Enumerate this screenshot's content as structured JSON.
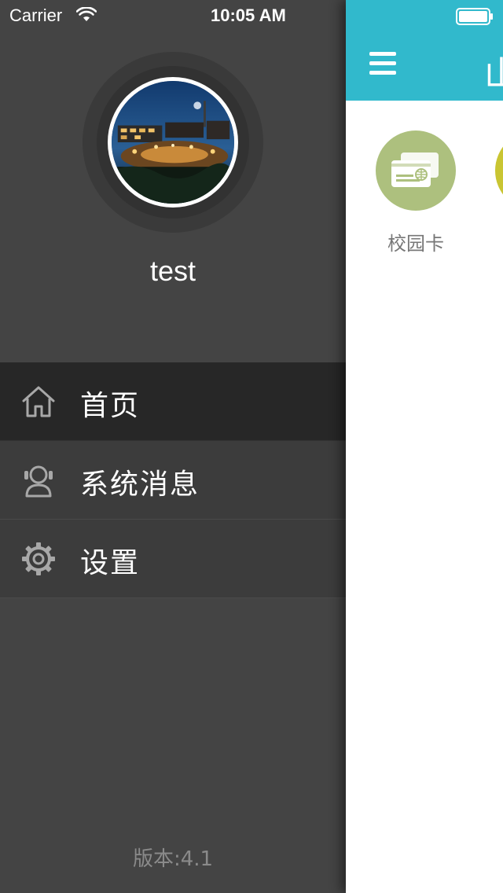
{
  "status_bar": {
    "carrier": "Carrier",
    "time": "10:05 AM",
    "wifi_icon": "wifi-icon",
    "battery_icon": "battery-icon"
  },
  "drawer": {
    "avatar_icon": "user-avatar-campus-night-photo",
    "username": "test",
    "menu": [
      {
        "label": "首页",
        "icon": "home-icon",
        "active": true
      },
      {
        "label": "系统消息",
        "icon": "user-message-icon",
        "active": false
      },
      {
        "label": "设置",
        "icon": "gear-icon",
        "active": false
      }
    ],
    "version": "版本:4.1"
  },
  "main": {
    "nav_title_fragment": "山",
    "menu_icon": "hamburger-menu-icon",
    "tiles": [
      {
        "label": "校园卡",
        "icon": "campus-card-icon",
        "color": "#adc07e"
      },
      {
        "label": "",
        "icon": "partial-tile-icon",
        "color": "#c9c532"
      }
    ],
    "nav_color": "#31b9cc"
  },
  "colors": {
    "drawer_bg": "#444444",
    "active_item_bg": "#272727",
    "menu_item_bg": "#3c3c3c",
    "accent": "#31b9cc"
  }
}
